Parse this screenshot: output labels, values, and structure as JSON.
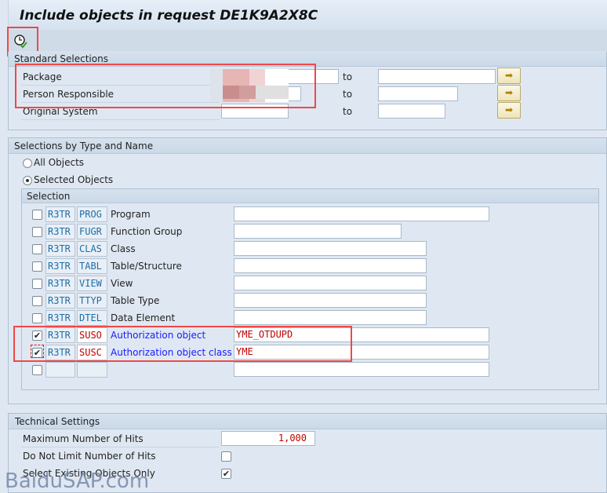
{
  "title": "Include objects in request DE1K9A2X8C",
  "toolbar": {
    "execute_icon": "clock-check-icon"
  },
  "standard": {
    "title": "Standard Selections",
    "to_label": "to",
    "rows": [
      {
        "label": "Package",
        "from": "",
        "to": ""
      },
      {
        "label": "Person Responsible",
        "from": "",
        "to": ""
      },
      {
        "label": "Original System",
        "from": "",
        "to": ""
      }
    ],
    "multi_select_icon": "arrow-right-icon"
  },
  "types": {
    "title": "Selections by Type and Name",
    "radio_all": "All Objects",
    "radio_selected": "Selected Objects",
    "selected_option": "Selected Objects",
    "selection_title": "Selection",
    "rows": [
      {
        "checked": false,
        "pgmid": "R3TR",
        "type": "PROG",
        "label": "Program",
        "value": ""
      },
      {
        "checked": false,
        "pgmid": "R3TR",
        "type": "FUGR",
        "label": "Function Group",
        "value": ""
      },
      {
        "checked": false,
        "pgmid": "R3TR",
        "type": "CLAS",
        "label": "Class",
        "value": ""
      },
      {
        "checked": false,
        "pgmid": "R3TR",
        "type": "TABL",
        "label": "Table/Structure",
        "value": ""
      },
      {
        "checked": false,
        "pgmid": "R3TR",
        "type": "VIEW",
        "label": "View",
        "value": ""
      },
      {
        "checked": false,
        "pgmid": "R3TR",
        "type": "TTYP",
        "label": "Table Type",
        "value": ""
      },
      {
        "checked": false,
        "pgmid": "R3TR",
        "type": "DTEL",
        "label": "Data Element",
        "value": ""
      },
      {
        "checked": true,
        "pgmid": "R3TR",
        "type": "SUSO",
        "label": "Authorization object",
        "value": "YME_OTDUPD"
      },
      {
        "checked": true,
        "pgmid": "R3TR",
        "type": "SUSC",
        "label": "Authorization object class",
        "value": "YME"
      },
      {
        "checked": false,
        "pgmid": "",
        "type": "",
        "label": "",
        "value": ""
      }
    ]
  },
  "technical": {
    "title": "Technical Settings",
    "max_hits_label": "Maximum Number of Hits",
    "max_hits_value": "1,000",
    "no_limit_label": "Do Not Limit Number of Hits",
    "no_limit_checked": false,
    "existing_label": "Select Existing Objects Only",
    "existing_checked": true
  },
  "watermark": "BaiduSAP.com",
  "colors": {
    "highlight": "#f04848",
    "selected_label": "#1a1aff",
    "value_red": "#c00000"
  }
}
